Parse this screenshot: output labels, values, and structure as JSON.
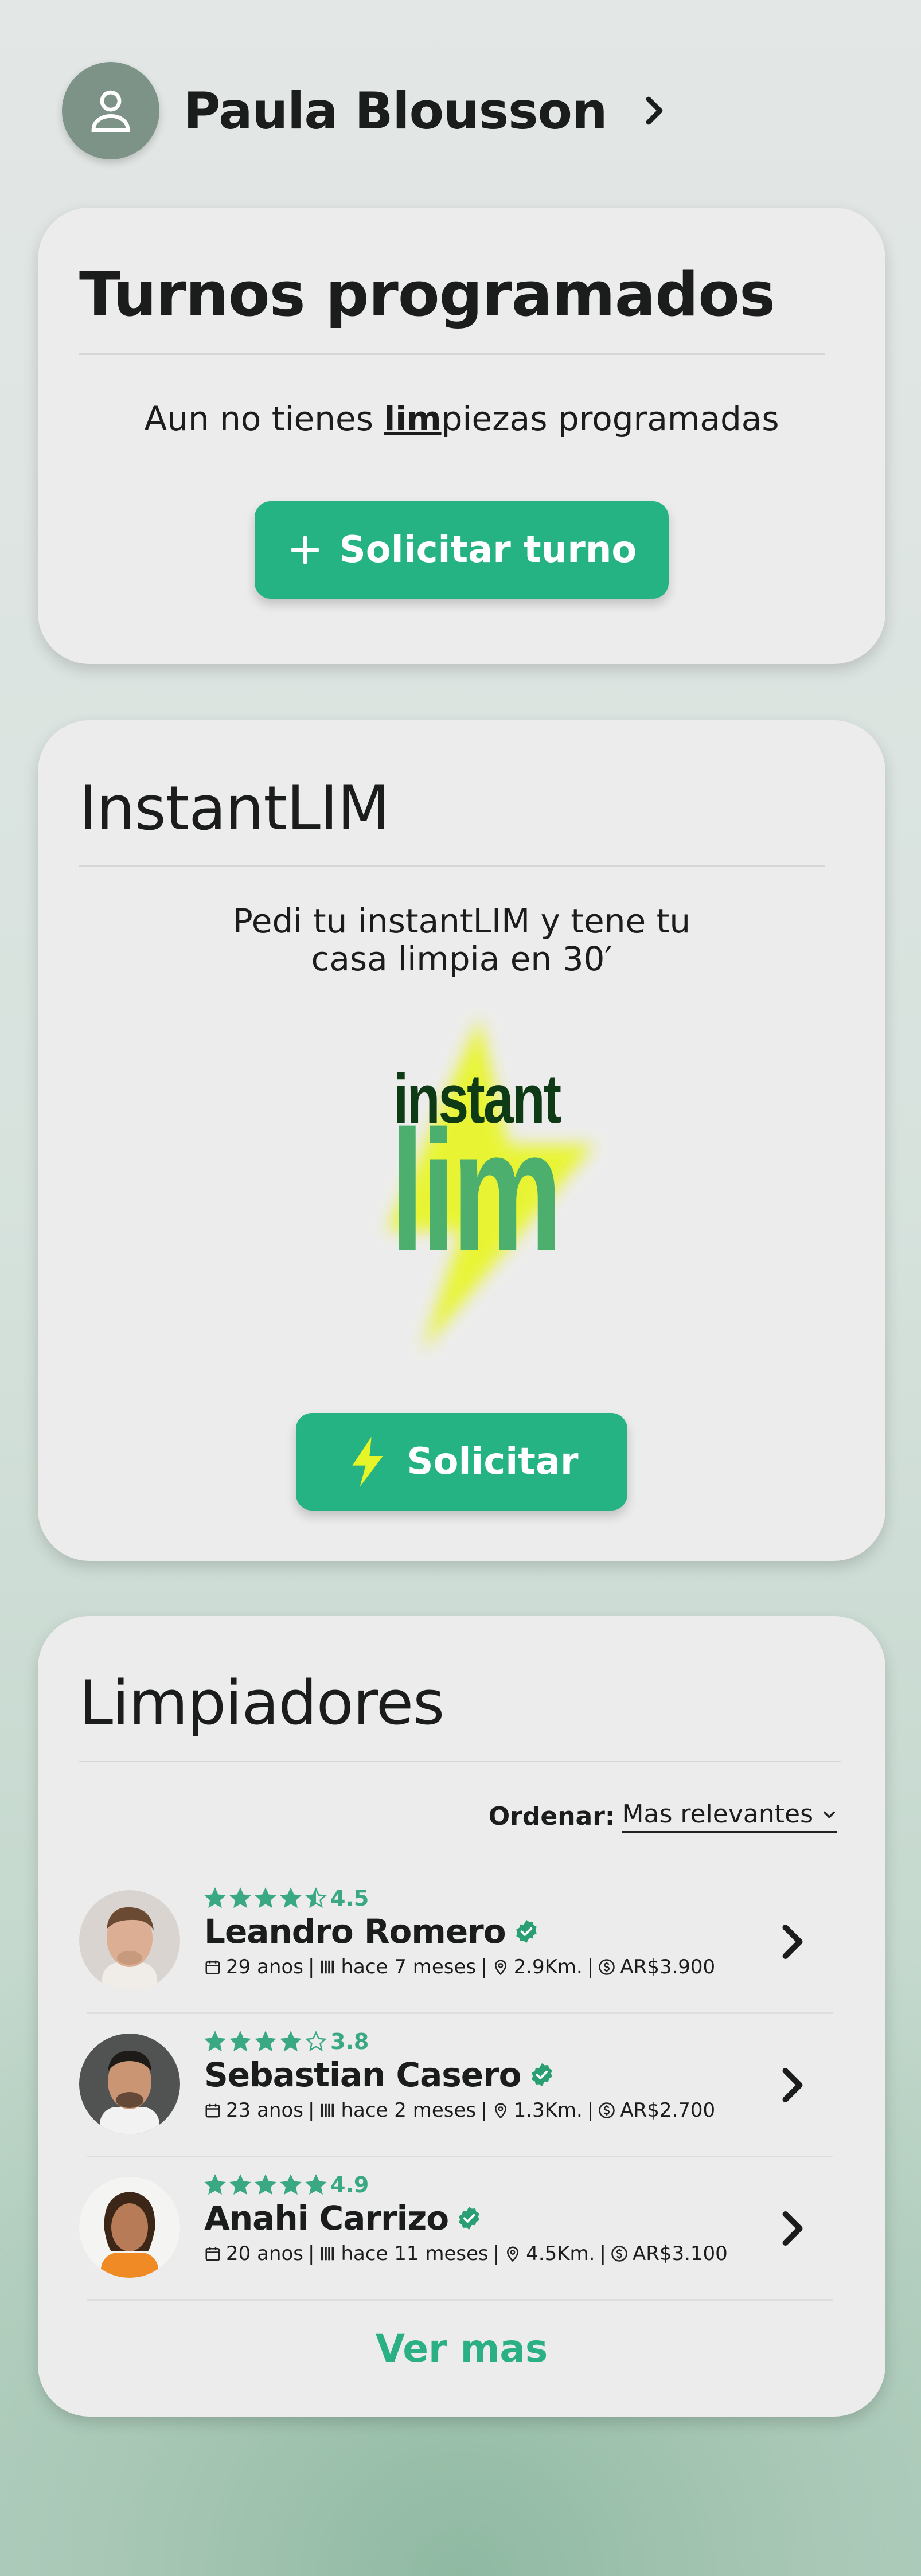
{
  "header": {
    "user_name": "Paula Blousson"
  },
  "turnos": {
    "title": "Turnos programados",
    "empty_pre": "Aun no tienes ",
    "empty_brand": "lim",
    "empty_post": "piezas programadas",
    "button_label": "Solicitar turno"
  },
  "instant": {
    "title": "InstantLIM",
    "description_line1": "Pedi tu instantLIM y tene tu",
    "description_line2": "casa limpia en 30′",
    "logo_text_top": "instant",
    "logo_text_bottom": "lim",
    "button_label": "Solicitar"
  },
  "cleaners": {
    "title": "Limpiadores",
    "sort_label": "Ordenar:",
    "sort_value": "Mas relevantes",
    "items": [
      {
        "rating": 4.5,
        "rating_text": "4.5",
        "name": "Leandro Romero",
        "age": "29 anos",
        "since": "hace 7 meses",
        "distance": "2.9Km.",
        "price": "AR$3.900"
      },
      {
        "rating": 3.8,
        "rating_text": "3.8",
        "name": "Sebastian Casero",
        "age": "23 anos",
        "since": "hace 2 meses",
        "distance": "1.3Km.",
        "price": "AR$2.700"
      },
      {
        "rating": 4.9,
        "rating_text": "4.9",
        "name": "Anahi Carrizo",
        "age": "20 anos",
        "since": "hace 11 meses",
        "distance": "4.5Km.",
        "price": "AR$3.100"
      }
    ],
    "see_more": "Ver mas"
  },
  "colors": {
    "accent": "#26b384",
    "star": "#3aa882",
    "bolt": "#e6f528",
    "logo_dark": "#0e3a15",
    "logo_green": "#4caf6d"
  }
}
